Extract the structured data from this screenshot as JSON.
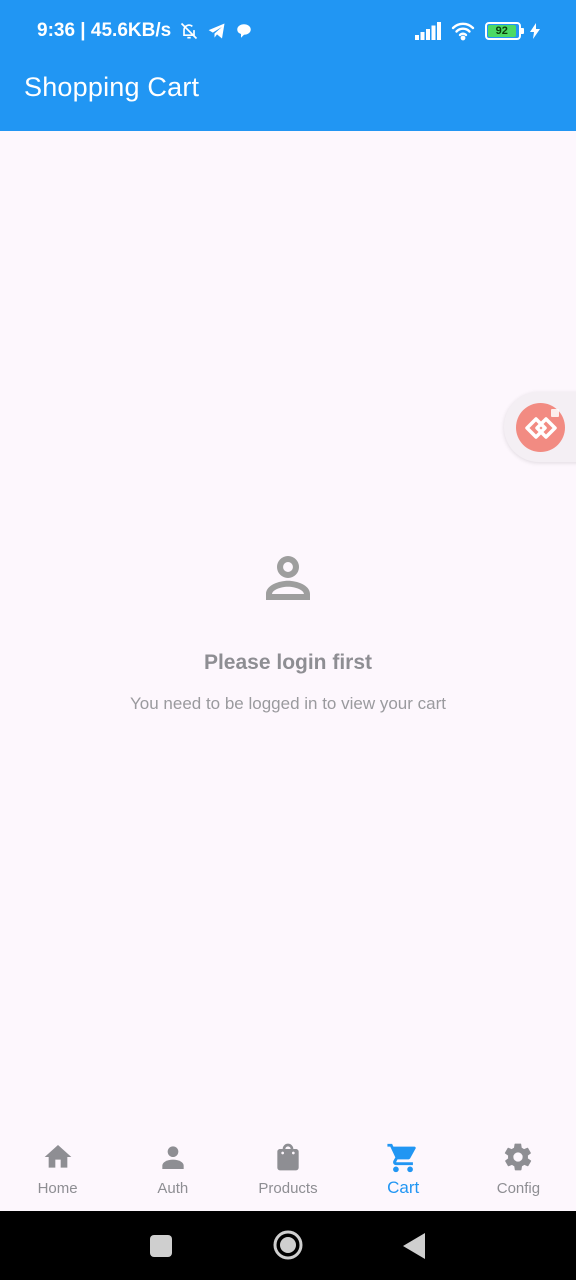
{
  "status_bar": {
    "time_speed": "9:36 | 45.6KB/s",
    "battery_level": "92",
    "icons": [
      "mute-bell-icon",
      "telegram-icon",
      "chat-bubble-icon",
      "signal-icon",
      "wifi-icon",
      "battery-icon",
      "charging-bolt-icon"
    ]
  },
  "app_bar": {
    "title": "Shopping Cart"
  },
  "empty_state": {
    "icon": "person-icon",
    "title": "Please login first",
    "subtitle": "You need to be logged in to view your cart"
  },
  "bottom_nav": {
    "items": [
      {
        "label": "Home",
        "icon": "home-icon",
        "active": false
      },
      {
        "label": "Auth",
        "icon": "person-icon",
        "active": false
      },
      {
        "label": "Products",
        "icon": "shopping-bag-icon",
        "active": false
      },
      {
        "label": "Cart",
        "icon": "cart-icon",
        "active": true
      },
      {
        "label": "Config",
        "icon": "gear-icon",
        "active": false
      }
    ]
  },
  "system_nav": {
    "buttons": [
      "recents-button",
      "home-button",
      "back-button"
    ]
  },
  "colors": {
    "primary": "#2196f3",
    "background": "#fdf7fd",
    "muted": "#8e8e93",
    "bubble": "#f28b82"
  }
}
